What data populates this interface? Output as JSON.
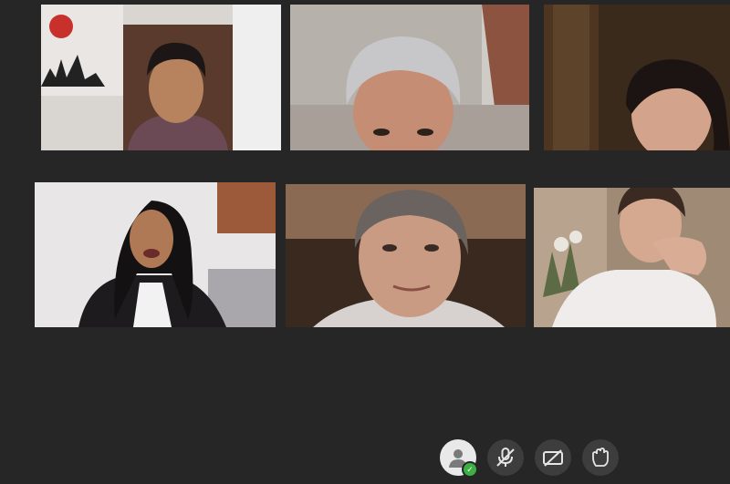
{
  "participants": [
    {
      "id": "p1",
      "camera": "on",
      "mic": "unknown"
    },
    {
      "id": "p2",
      "camera": "on",
      "mic": "unknown"
    },
    {
      "id": "p3",
      "camera": "on",
      "mic": "unknown"
    },
    {
      "id": "p4",
      "camera": "on",
      "mic": "unknown"
    },
    {
      "id": "p5",
      "camera": "on",
      "mic": "unknown"
    },
    {
      "id": "p6",
      "camera": "on",
      "mic": "unknown"
    }
  ],
  "controls": [
    {
      "name": "self-view",
      "icon": "user-avatar-icon",
      "status_badge": "check-icon",
      "badge_color": "#3cb043"
    },
    {
      "name": "microphone",
      "icon": "mic-off-icon",
      "state": "muted"
    },
    {
      "name": "camera",
      "icon": "camera-off-icon",
      "state": "off"
    },
    {
      "name": "raise-hand",
      "icon": "hand-icon",
      "state": "inactive"
    }
  ],
  "colors": {
    "background": "#262626",
    "control_bg": "#3d3d3d",
    "icon": "#e6e6e6",
    "accent_green": "#3cb043"
  }
}
